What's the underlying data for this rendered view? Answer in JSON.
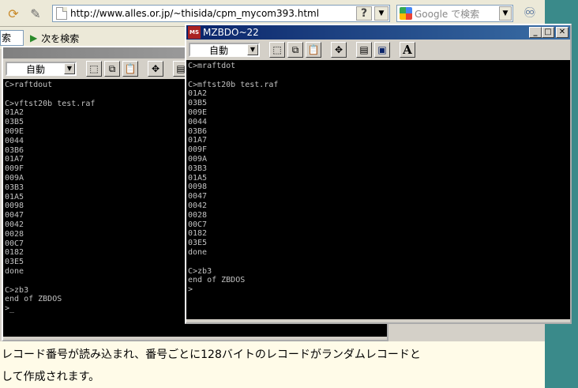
{
  "browser": {
    "url": "http://www.alles.or.jp/~thisida/cpm_mycom393.html",
    "help_label": "?",
    "search_placeholder": "Google で検索"
  },
  "findbar": {
    "field_value": "索",
    "next_label": "次を検索"
  },
  "back_window": {
    "font_value": "自動",
    "lines": "C>raftdout\n\nC>vftst20b test.raf\n01A2\n03B5\n009E\n0044\n03B6\n01A7\n009F\n009A\n03B3\n01A5\n0098\n0047\n0042\n0028\n00C7\n0182\n03E5\ndone\n\nC>zb3\nend of ZBDOS\n>_"
  },
  "front_window": {
    "title": "MZBDO~22",
    "icon_letters": "MS",
    "font_value": "自動",
    "lines": "C>mraftdot\n\nC>mftst20b test.raf\n01A2\n03B5\n009E\n0044\n03B6\n01A7\n009F\n009A\n03B3\n01A5\n0098\n0047\n0042\n0028\n00C7\n0182\n03E5\ndone\n\nC>zb3\nend of ZBDOS\n>"
  },
  "page": {
    "line1": "レコード番号が読み込まれ、番号ごとに128バイトのレコードがランダムレコードと",
    "line2": "して作成されます。"
  }
}
